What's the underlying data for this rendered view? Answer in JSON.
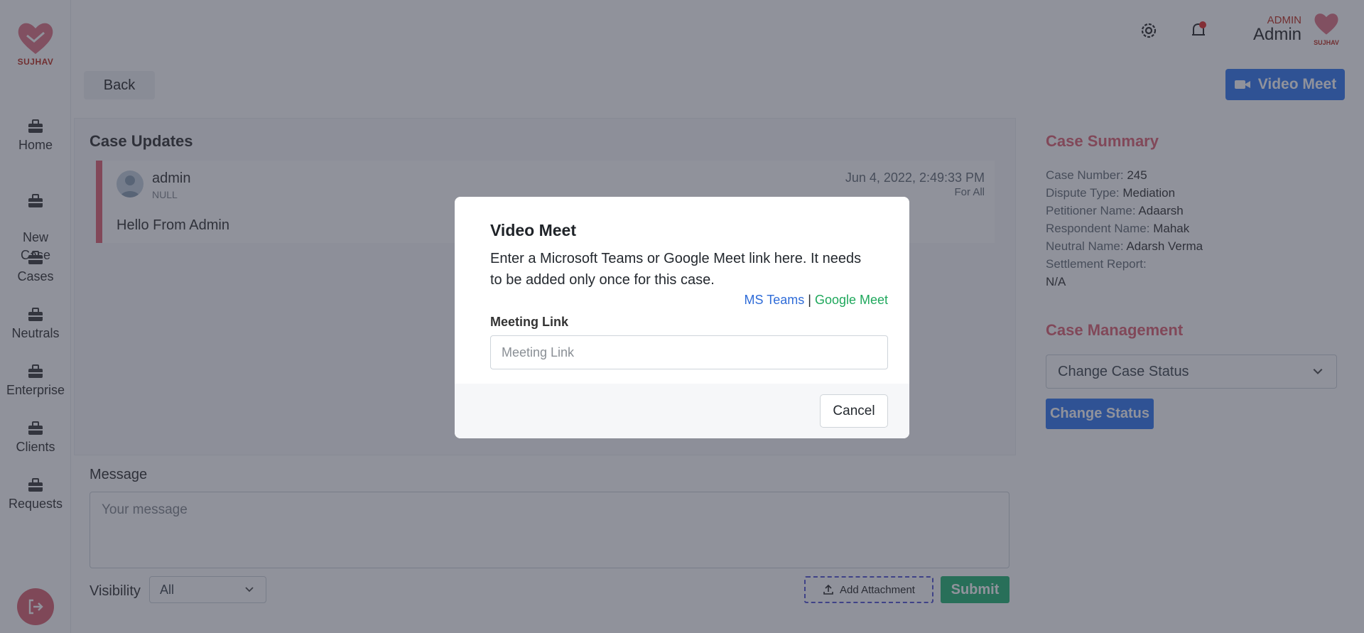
{
  "sidebar": {
    "logo_text": "SUJHAV",
    "items": [
      {
        "label": "Home"
      },
      {
        "label": "New\nCase"
      },
      {
        "label": "Cases"
      },
      {
        "label": "Neutrals"
      },
      {
        "label": "Enterprise"
      },
      {
        "label": "Clients"
      },
      {
        "label": "Requests"
      }
    ]
  },
  "header": {
    "user_role": "ADMIN",
    "user_name": "Admin",
    "avatar_text": "SUJHAV"
  },
  "toolbar": {
    "back_label": "Back",
    "video_meet_label": "Video Meet"
  },
  "updates": {
    "title": "Case Updates",
    "items": [
      {
        "author": "admin",
        "subtitle": "NULL",
        "date": "Jun 4, 2022, 2:49:33 PM",
        "visibility": "For All",
        "message": "Hello From Admin"
      }
    ]
  },
  "composer": {
    "label": "Message",
    "placeholder": "Your message",
    "visibility_label": "Visibility",
    "visibility_value": "All",
    "attach_label": "Add Attachment",
    "submit_label": "Submit"
  },
  "summary": {
    "title": "Case Summary",
    "rows": [
      {
        "label": "Case Number:",
        "value": "245"
      },
      {
        "label": "Dispute Type:",
        "value": "Mediation"
      },
      {
        "label": "Petitioner Name:",
        "value": "Adaarsh"
      },
      {
        "label": "Respondent Name:",
        "value": "Mahak"
      },
      {
        "label": "Neutral Name:",
        "value": "Adarsh Verma"
      },
      {
        "label": "Settlement Report:",
        "value": ""
      }
    ],
    "settlement_value": "N/A"
  },
  "management": {
    "title": "Case Management",
    "status_select": "Change Case Status",
    "change_button": "Change Status"
  },
  "modal": {
    "title": "Video Meet",
    "description": "Enter a Microsoft Teams or Google Meet link here. It needs to be added only once for this case.",
    "link_teams": "MS Teams",
    "separator": "|",
    "link_meet": "Google Meet",
    "field_label": "Meeting Link",
    "field_placeholder": "Meeting Link",
    "cancel_label": "Cancel"
  },
  "colors": {
    "primary": "#3c7ff0",
    "success": "#2eb87a",
    "accent": "#e06b7b",
    "overlay": "#212537"
  }
}
